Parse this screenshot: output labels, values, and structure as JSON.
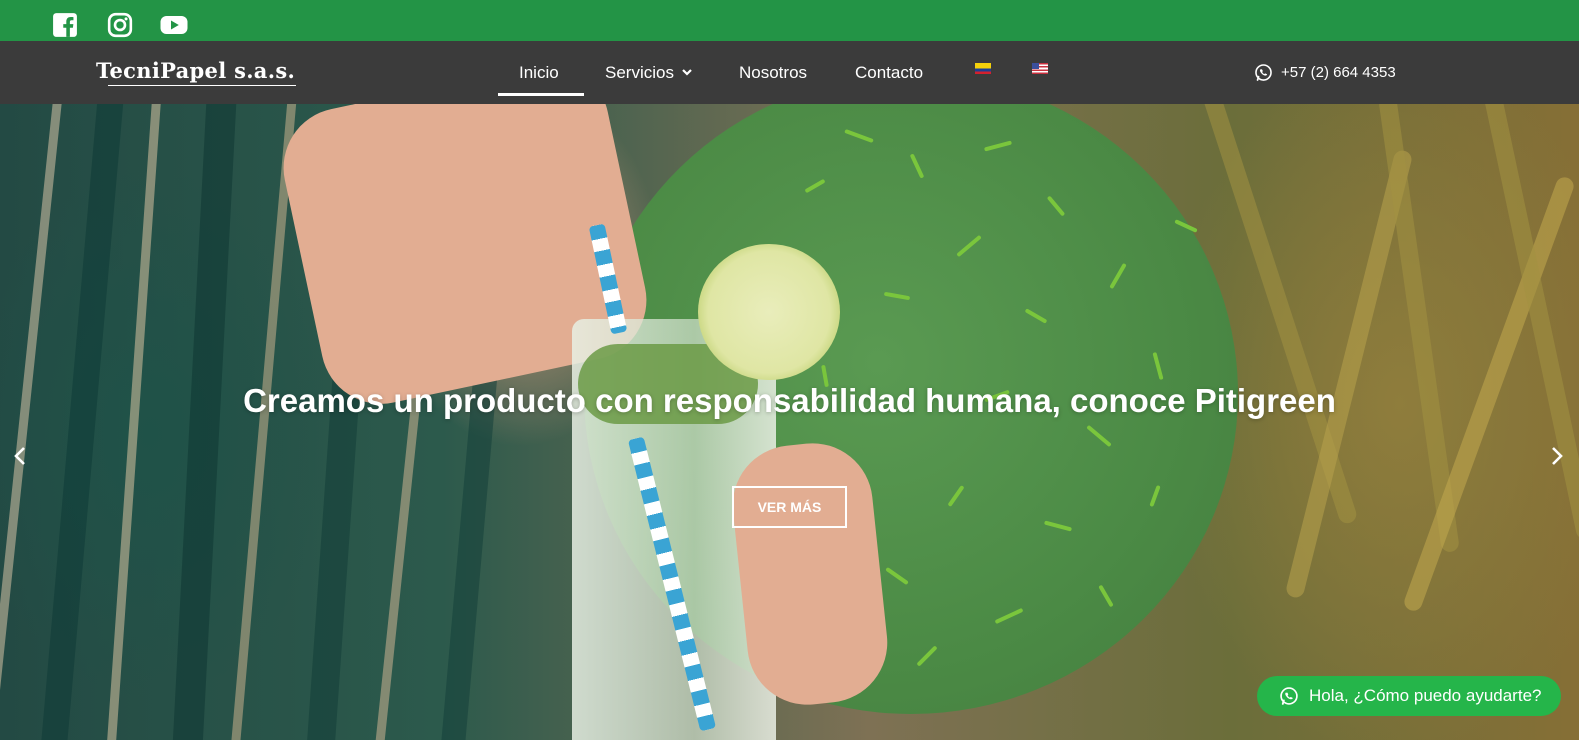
{
  "topbar": {
    "bg_color": "#239446",
    "social": [
      {
        "icon": "facebook-icon"
      },
      {
        "icon": "instagram-icon"
      },
      {
        "icon": "youtube-icon"
      }
    ]
  },
  "nav": {
    "logo_text": "TecniPapel s.a.s.",
    "items": [
      {
        "label": "Inicio",
        "active": true
      },
      {
        "label": "Servicios",
        "has_dropdown": true
      },
      {
        "label": "Nosotros"
      },
      {
        "label": "Contacto"
      }
    ],
    "languages": [
      {
        "icon": "flag-colombia-icon"
      },
      {
        "icon": "flag-usa-icon"
      }
    ],
    "phone": "+57 (2) 664 4353",
    "bg_color": "#3b3b3b"
  },
  "hero": {
    "title": "Creamos un producto con responsabilidad humana, conoce Pitigreen",
    "cta_label": "VER MÁS",
    "prev_icon": "chevron-left-icon",
    "next_icon": "chevron-right-icon"
  },
  "chat": {
    "label": "Hola, ¿Cómo puedo ayudarte?",
    "icon": "whatsapp-icon",
    "color": "#25b54a"
  }
}
